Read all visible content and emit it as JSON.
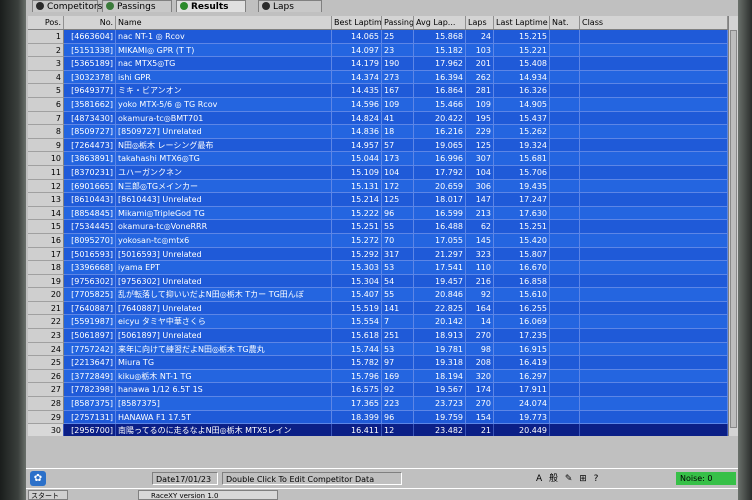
{
  "tabs": [
    {
      "label": "Competitors",
      "color": "#2a2a2a"
    },
    {
      "label": "Passings",
      "color": "#3a7a3a"
    },
    {
      "label": "Results",
      "color": "#2a8a2a",
      "active": true
    },
    {
      "label": "Laps",
      "color": "#2a2a2a"
    }
  ],
  "columns": {
    "pos": "Pos.",
    "no": "No.",
    "name": "Name",
    "best": "Best Laptime",
    "passing": "Passing",
    "avg": "Avg Lap...",
    "laps": "Laps",
    "last": "Last Laptime",
    "nat": "Nat.",
    "class": "Class"
  },
  "rows": [
    {
      "pos": "1",
      "no": "[4663604]",
      "name": "nac NT-1 ◎ Rcov",
      "best": "14.065",
      "passing": "25",
      "avg": "15.868",
      "laps": "24",
      "last": "15.215"
    },
    {
      "pos": "2",
      "no": "[5151338]",
      "name": "MIKAMI◎ GPR (T T)",
      "best": "14.097",
      "passing": "23",
      "avg": "15.182",
      "laps": "103",
      "last": "15.221"
    },
    {
      "pos": "3",
      "no": "[5365189]",
      "name": "nac MTX5◎TG",
      "best": "14.179",
      "passing": "190",
      "avg": "17.962",
      "laps": "201",
      "last": "15.408"
    },
    {
      "pos": "4",
      "no": "[3032378]",
      "name": "ishi GPR",
      "best": "14.374",
      "passing": "273",
      "avg": "16.394",
      "laps": "262",
      "last": "14.934"
    },
    {
      "pos": "5",
      "no": "[9649377]",
      "name": "ミキ・ビアンオン",
      "best": "14.435",
      "passing": "167",
      "avg": "16.864",
      "laps": "281",
      "last": "16.326"
    },
    {
      "pos": "6",
      "no": "[3581662]",
      "name": "yoko MTX-5/6 ◎ TG Rcov",
      "best": "14.596",
      "passing": "109",
      "avg": "15.466",
      "laps": "109",
      "last": "14.905"
    },
    {
      "pos": "7",
      "no": "[4873430]",
      "name": "okamura-tc◎BMT701",
      "best": "14.824",
      "passing": "41",
      "avg": "20.422",
      "laps": "195",
      "last": "15.437"
    },
    {
      "pos": "8",
      "no": "[8509727]",
      "name": "[8509727] Unrelated",
      "best": "14.836",
      "passing": "18",
      "avg": "16.216",
      "laps": "229",
      "last": "15.262"
    },
    {
      "pos": "9",
      "no": "[7264473]",
      "name": "N田◎栃木 レーシング最布",
      "best": "14.957",
      "passing": "57",
      "avg": "19.065",
      "laps": "125",
      "last": "19.324"
    },
    {
      "pos": "10",
      "no": "[3863891]",
      "name": "takahashi MTX6◎TG",
      "best": "15.044",
      "passing": "173",
      "avg": "16.996",
      "laps": "307",
      "last": "15.681"
    },
    {
      "pos": "11",
      "no": "[8370231]",
      "name": "ユハーガンクネン",
      "best": "15.109",
      "passing": "104",
      "avg": "17.792",
      "laps": "104",
      "last": "15.706"
    },
    {
      "pos": "12",
      "no": "[6901665]",
      "name": "N三郎◎TGメインカー",
      "best": "15.131",
      "passing": "172",
      "avg": "20.659",
      "laps": "306",
      "last": "19.435"
    },
    {
      "pos": "13",
      "no": "[8610443]",
      "name": "[8610443] Unrelated",
      "best": "15.214",
      "passing": "125",
      "avg": "18.017",
      "laps": "147",
      "last": "17.247"
    },
    {
      "pos": "14",
      "no": "[8854845]",
      "name": "Mikami◎TripleGod TG",
      "best": "15.222",
      "passing": "96",
      "avg": "16.599",
      "laps": "213",
      "last": "17.630"
    },
    {
      "pos": "15",
      "no": "[7534445]",
      "name": "okamura-tc◎VoneRRR",
      "best": "15.251",
      "passing": "55",
      "avg": "16.488",
      "laps": "62",
      "last": "15.251"
    },
    {
      "pos": "16",
      "no": "[8095270]",
      "name": "yokosan-tc◎mtx6",
      "best": "15.272",
      "passing": "70",
      "avg": "17.055",
      "laps": "145",
      "last": "15.420"
    },
    {
      "pos": "17",
      "no": "[5016593]",
      "name": "[5016593] Unrelated",
      "best": "15.292",
      "passing": "317",
      "avg": "21.297",
      "laps": "323",
      "last": "15.807"
    },
    {
      "pos": "18",
      "no": "[3396668]",
      "name": "iyama EPT",
      "best": "15.303",
      "passing": "53",
      "avg": "17.541",
      "laps": "110",
      "last": "16.670"
    },
    {
      "pos": "19",
      "no": "[9756302]",
      "name": "[9756302] Unrelated",
      "best": "15.304",
      "passing": "54",
      "avg": "19.457",
      "laps": "216",
      "last": "16.858"
    },
    {
      "pos": "20",
      "no": "[7705825]",
      "name": "乱が転落して抑いいだよN田◎栃木 Tカー TG田んぼ",
      "best": "15.407",
      "passing": "55",
      "avg": "20.846",
      "laps": "92",
      "last": "15.610"
    },
    {
      "pos": "21",
      "no": "[7640887]",
      "name": "[7640887] Unrelated",
      "best": "15.519",
      "passing": "141",
      "avg": "22.825",
      "laps": "164",
      "last": "16.255"
    },
    {
      "pos": "22",
      "no": "[5591987]",
      "name": "eicyu タミヤ中華さくら",
      "best": "15.554",
      "passing": "7",
      "avg": "20.142",
      "laps": "14",
      "last": "16.069"
    },
    {
      "pos": "23",
      "no": "[5061897]",
      "name": "[5061897] Unrelated",
      "best": "15.618",
      "passing": "251",
      "avg": "18.913",
      "laps": "270",
      "last": "17.235"
    },
    {
      "pos": "24",
      "no": "[7757242]",
      "name": "来年に向けて練習だよN田◎栃木 TG農丸",
      "best": "15.744",
      "passing": "53",
      "avg": "19.781",
      "laps": "98",
      "last": "16.915"
    },
    {
      "pos": "25",
      "no": "[2213647]",
      "name": "Miura TG",
      "best": "15.782",
      "passing": "97",
      "avg": "19.318",
      "laps": "208",
      "last": "16.419"
    },
    {
      "pos": "26",
      "no": "[3772849]",
      "name": "kiku◎栃木 NT-1 TG",
      "best": "15.796",
      "passing": "169",
      "avg": "18.194",
      "laps": "320",
      "last": "16.297"
    },
    {
      "pos": "27",
      "no": "[7782398]",
      "name": "hanawa 1/12 6.5T 1S",
      "best": "16.575",
      "passing": "92",
      "avg": "19.567",
      "laps": "174",
      "last": "17.911"
    },
    {
      "pos": "28",
      "no": "[8587375]",
      "name": "[8587375]",
      "best": "17.365",
      "passing": "223",
      "avg": "23.723",
      "laps": "270",
      "last": "24.074"
    },
    {
      "pos": "29",
      "no": "[2757131]",
      "name": "HANAWA F1 17.5T",
      "best": "18.399",
      "passing": "96",
      "avg": "19.759",
      "laps": "154",
      "last": "19.773"
    },
    {
      "pos": "30",
      "no": "[2956700]",
      "name": "南陽ってるのに走るなよN田◎栃木 MTX5レイン",
      "best": "16.411",
      "passing": "12",
      "avg": "23.482",
      "laps": "21",
      "last": "20.449",
      "selected": true
    }
  ],
  "status": {
    "date": "Date17/01/23",
    "hint": "Double Click To Edit Competitor Data",
    "noise": "Noise: 0",
    "ime": "A 般 ✎ ⊞ ?"
  },
  "taskbar": {
    "start": "スタート",
    "task": "RaceXY version 1.0"
  }
}
